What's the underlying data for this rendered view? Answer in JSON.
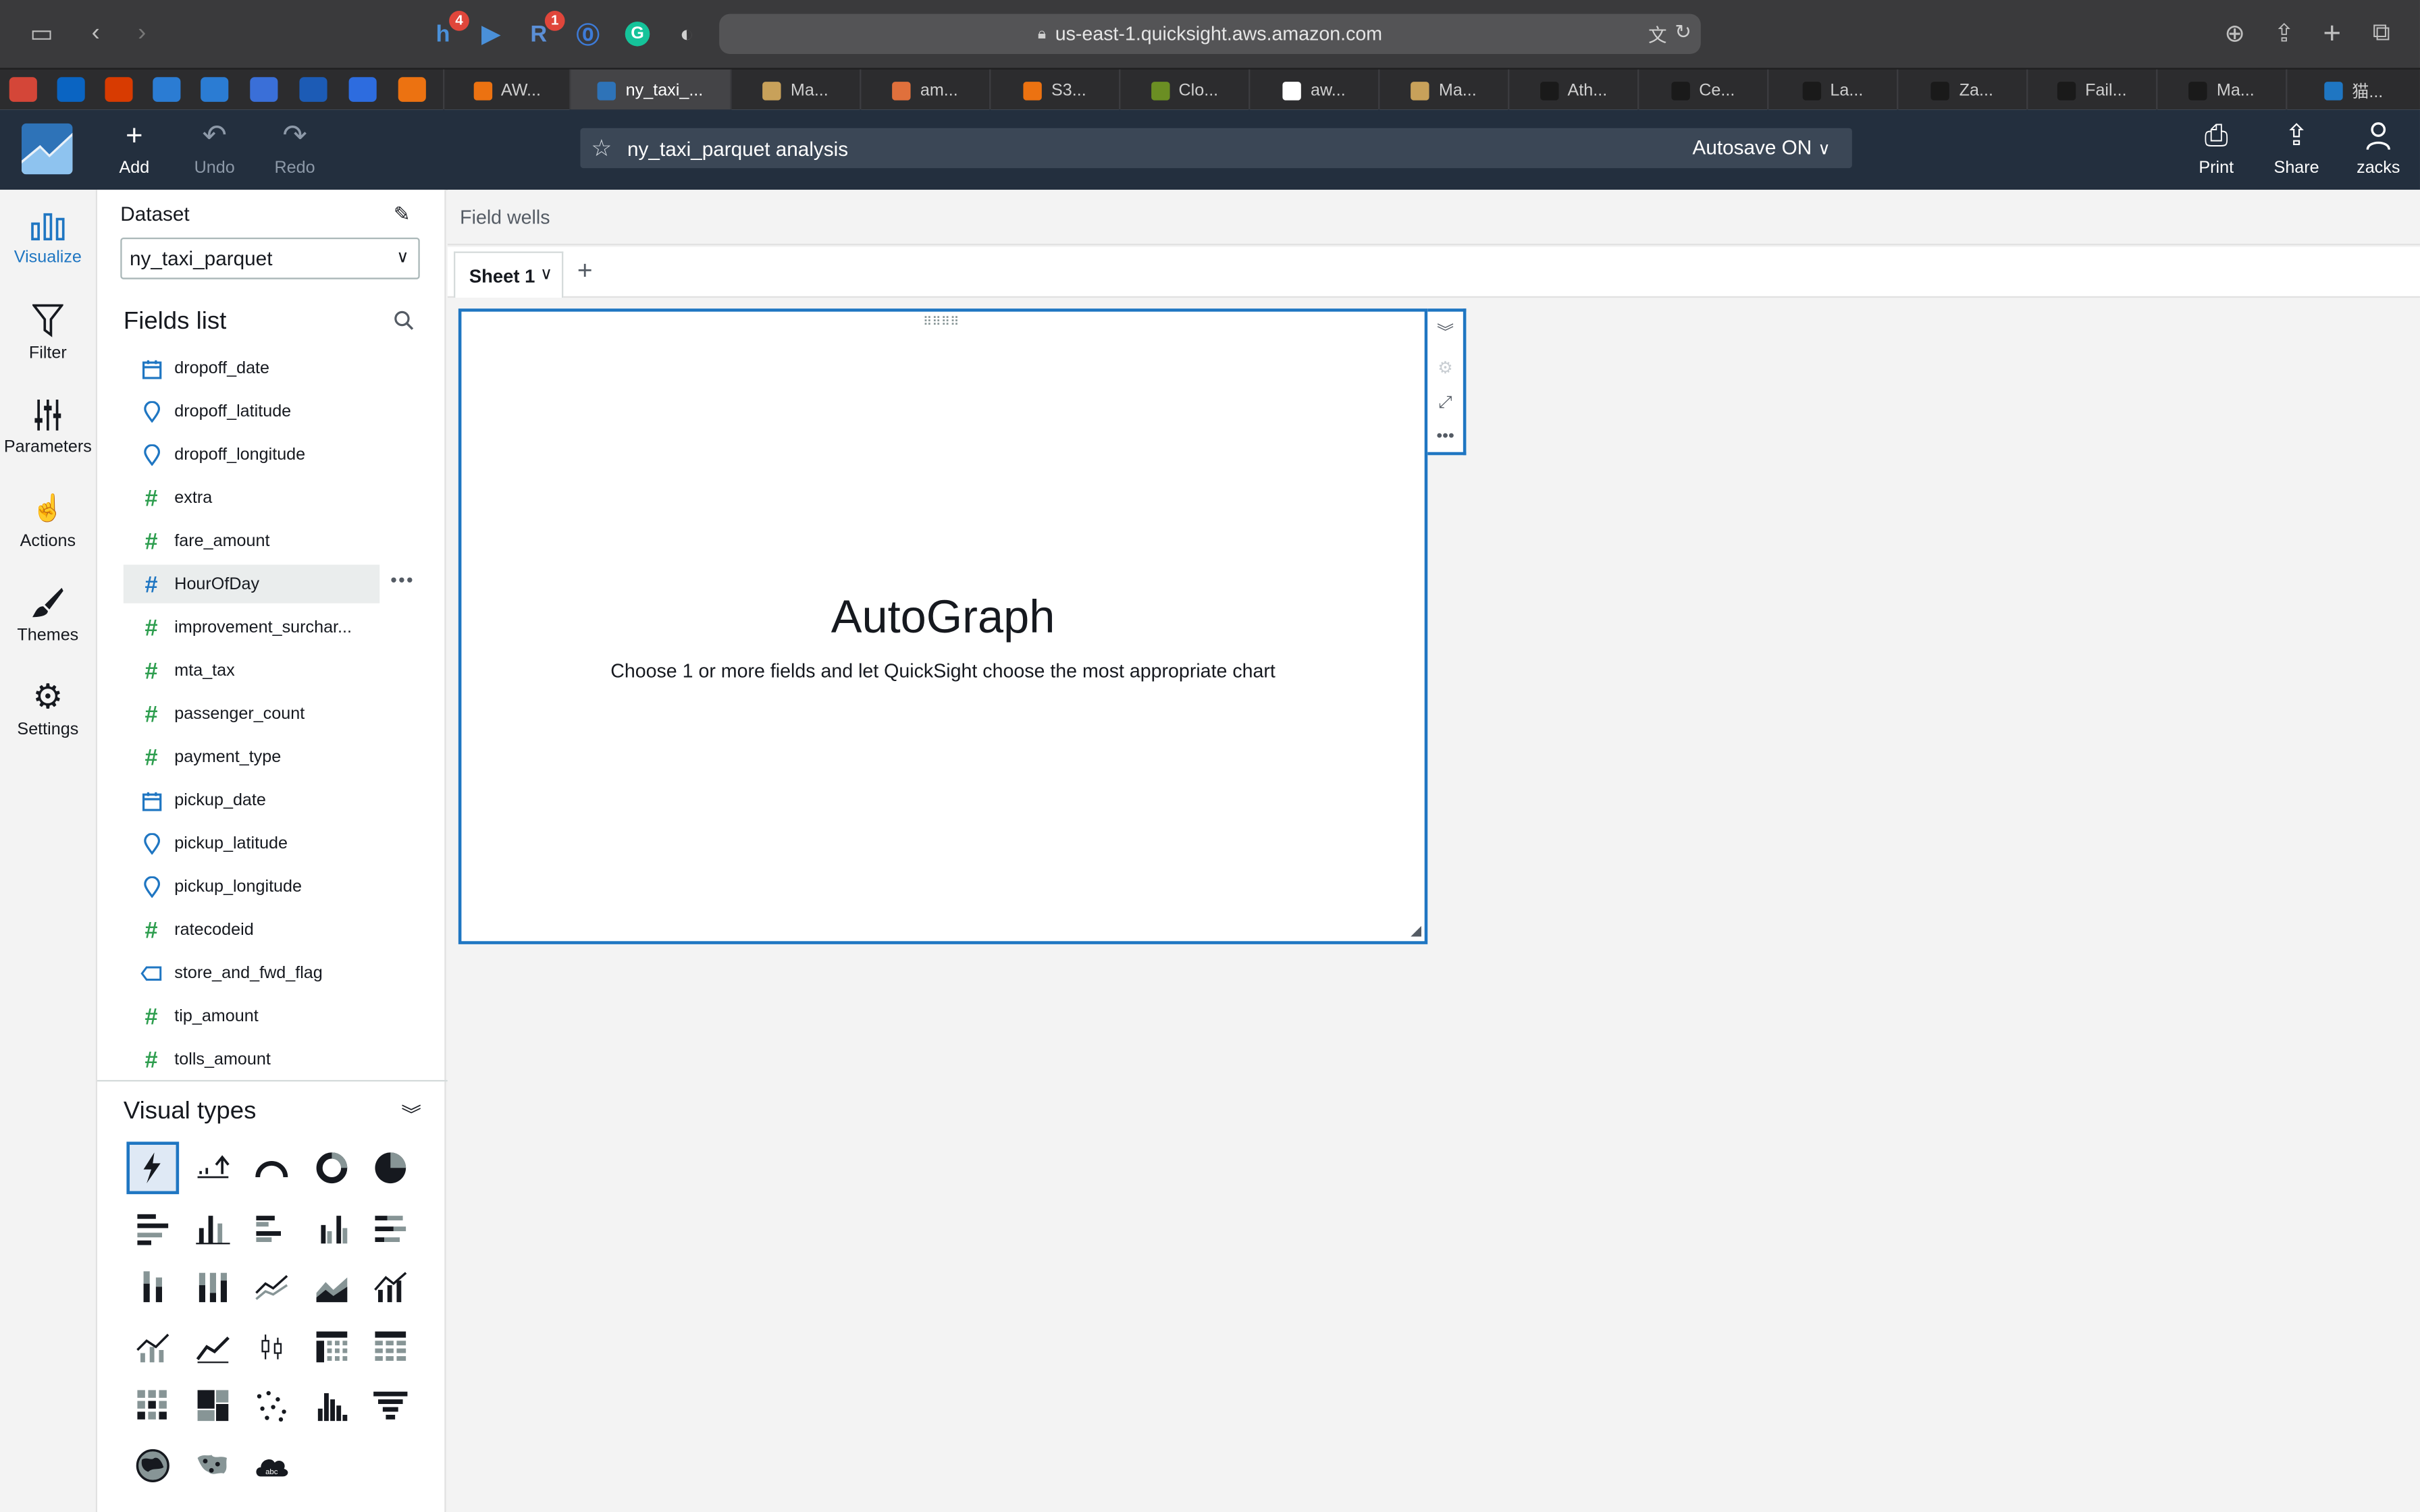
{
  "browser": {
    "url": "us-east-1.quicksight.aws.amazon.com",
    "extension_badges": [
      "4",
      "1"
    ],
    "tabs": [
      {
        "label": "AW...",
        "color": "#ec7211",
        "active": false
      },
      {
        "label": "ny_taxi_...",
        "color": "#2e73b8",
        "active": true
      },
      {
        "label": "Ma...",
        "color": "#c8a15a",
        "active": false
      },
      {
        "label": "am...",
        "color": "#e0703c",
        "active": false
      },
      {
        "label": "S3...",
        "color": "#ec7211",
        "active": false
      },
      {
        "label": "Clo...",
        "color": "#6b8e23",
        "active": false
      },
      {
        "label": "aw...",
        "color": "#ffffff",
        "active": false
      },
      {
        "label": "Ma...",
        "color": "#c8a15a",
        "active": false
      },
      {
        "label": "Ath...",
        "color": "#1a1a1a",
        "active": false
      },
      {
        "label": "Ce...",
        "color": "#1a1a1a",
        "active": false
      },
      {
        "label": "La...",
        "color": "#1a1a1a",
        "active": false
      },
      {
        "label": "Za...",
        "color": "#1a1a1a",
        "active": false
      },
      {
        "label": "Fail...",
        "color": "#1a1a1a",
        "active": false
      },
      {
        "label": "Ma...",
        "color": "#1a1a1a",
        "active": false
      },
      {
        "label": "猫...",
        "color": "#1f76c2",
        "active": false
      }
    ]
  },
  "header": {
    "add_label": "Add",
    "undo_label": "Undo",
    "redo_label": "Redo",
    "analysis_name": "ny_taxi_parquet analysis",
    "autosave_label": "Autosave ON",
    "print_label": "Print",
    "share_label": "Share",
    "user_label": "zacks"
  },
  "nav": {
    "items": [
      {
        "label": "Visualize",
        "icon": "bar-chart-icon"
      },
      {
        "label": "Filter",
        "icon": "filter-icon"
      },
      {
        "label": "Parameters",
        "icon": "sliders-icon"
      },
      {
        "label": "Actions",
        "icon": "pointer-gear-icon"
      },
      {
        "label": "Themes",
        "icon": "brush-icon"
      },
      {
        "label": "Settings",
        "icon": "gear-icon"
      }
    ]
  },
  "panel": {
    "dataset_label": "Dataset",
    "dataset_value": "ny_taxi_parquet",
    "fields_title": "Fields list",
    "fields": [
      {
        "name": "dropoff_date",
        "type": "date"
      },
      {
        "name": "dropoff_latitude",
        "type": "geo"
      },
      {
        "name": "dropoff_longitude",
        "type": "geo"
      },
      {
        "name": "extra",
        "type": "measure"
      },
      {
        "name": "fare_amount",
        "type": "measure"
      },
      {
        "name": "HourOfDay",
        "type": "dimension-num"
      },
      {
        "name": "improvement_surchar...",
        "type": "measure"
      },
      {
        "name": "mta_tax",
        "type": "measure"
      },
      {
        "name": "passenger_count",
        "type": "measure"
      },
      {
        "name": "payment_type",
        "type": "measure"
      },
      {
        "name": "pickup_date",
        "type": "date"
      },
      {
        "name": "pickup_latitude",
        "type": "geo"
      },
      {
        "name": "pickup_longitude",
        "type": "geo"
      },
      {
        "name": "ratecodeid",
        "type": "measure"
      },
      {
        "name": "store_and_fwd_flag",
        "type": "text"
      },
      {
        "name": "tip_amount",
        "type": "measure"
      },
      {
        "name": "tolls_amount",
        "type": "measure"
      }
    ],
    "hovered_field": "HourOfDay",
    "visual_types_title": "Visual types",
    "visual_types": [
      "autograph-icon",
      "kpi-icon",
      "gauge-icon",
      "donut-chart-icon",
      "pie-chart-icon",
      "horizontal-bar-icon",
      "vertical-bar-icon",
      "clustered-horizontal-bar-icon",
      "clustered-vertical-bar-icon",
      "stacked-horizontal-bar-icon",
      "stacked-vertical-bar-icon",
      "percent-stacked-bar-icon",
      "line-chart-icon",
      "area-chart-icon",
      "combo-bar-line-icon",
      "combo-line-icon",
      "stacked-area-icon",
      "box-plot-icon",
      "pivot-table-icon",
      "table-icon",
      "heat-map-icon",
      "tree-map-icon",
      "scatter-plot-icon",
      "histogram-icon",
      "funnel-icon",
      "filled-map-icon",
      "point-map-icon",
      "word-cloud-icon"
    ]
  },
  "main": {
    "field_wells_label": "Field wells",
    "sheet_tab_label": "Sheet 1",
    "visual_title": "AutoGraph",
    "visual_subtitle": "Choose 1 or more fields and let QuickSight choose the most appropriate chart"
  },
  "colors": {
    "accent": "#1f76c2",
    "header_bg": "#232f3e",
    "measure_icon": "#2e9e4f",
    "dimension_icon": "#1f76c2"
  }
}
